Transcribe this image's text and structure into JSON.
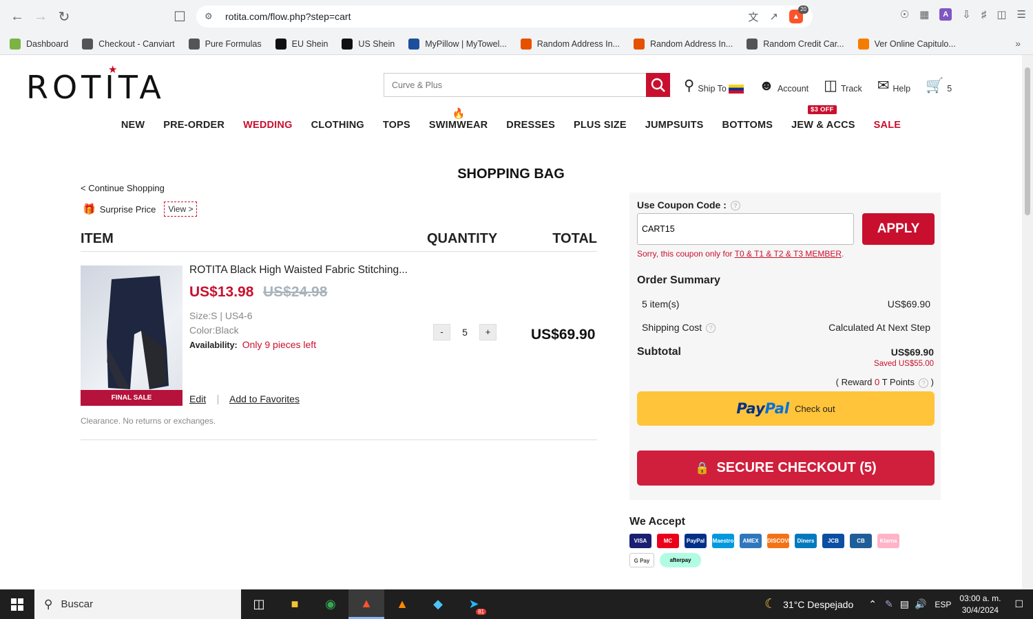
{
  "browser": {
    "url": "rotita.com/flow.php?step=cart",
    "extension_badge_count": "20"
  },
  "bookmarks": [
    {
      "label": "Dashboard",
      "color": "#7cb342"
    },
    {
      "label": "Checkout - Canviart",
      "color": "#555555"
    },
    {
      "label": "Pure Formulas",
      "color": "#555555"
    },
    {
      "label": "EU Shein",
      "color": "#111111"
    },
    {
      "label": "US Shein",
      "color": "#111111"
    },
    {
      "label": "MyPillow | MyTowel...",
      "color": "#1e4f9c"
    },
    {
      "label": "Random Address In...",
      "color": "#e65100"
    },
    {
      "label": "Random Address In...",
      "color": "#e65100"
    },
    {
      "label": "Random Credit Car...",
      "color": "#555555"
    },
    {
      "label": "Ver Online Capitulo...",
      "color": "#f57c00"
    }
  ],
  "site": {
    "logo": "ROTITA",
    "search_placeholder": "Curve & Plus",
    "header_links": {
      "ship_to": "Ship To",
      "account": "Account",
      "track": "Track",
      "help": "Help",
      "cart_count": "5"
    },
    "nav": [
      {
        "label": "NEW",
        "red": false
      },
      {
        "label": "PRE-ORDER",
        "red": false
      },
      {
        "label": "WEDDING",
        "red": true
      },
      {
        "label": "CLOTHING",
        "red": false
      },
      {
        "label": "TOPS",
        "red": false
      },
      {
        "label": "SWIMWEAR",
        "red": false
      },
      {
        "label": "DRESSES",
        "red": false
      },
      {
        "label": "PLUS SIZE",
        "red": false
      },
      {
        "label": "JUMPSUITS",
        "red": false
      },
      {
        "label": "BOTTOMS",
        "red": false
      },
      {
        "label": "JEW & ACCS",
        "red": false
      },
      {
        "label": "SALE",
        "red": true
      }
    ],
    "jew_badge": "$3 OFF"
  },
  "cart": {
    "title": "SHOPPING BAG",
    "continue": "< Continue Shopping",
    "surprise": "Surprise Price",
    "view": "View >",
    "headers": {
      "item": "ITEM",
      "quantity": "QUANTITY",
      "total": "TOTAL"
    },
    "item": {
      "name": "ROTITA Black High Waisted Fabric Stitching...",
      "price": "US$13.98",
      "old_price": "US$24.98",
      "size": "Size:S | US4-6",
      "color": "Color:Black",
      "availability_label": "Availability:",
      "availability_value": "Only 9 pieces left",
      "badge": "FINAL SALE",
      "qty_minus": "-",
      "qty": "5",
      "qty_plus": "+",
      "total": "US$69.90",
      "edit": "Edit",
      "favorites": "Add to Favorites",
      "note": "Clearance. No returns or exchanges."
    }
  },
  "summary": {
    "coupon_label": "Use Coupon Code :",
    "coupon_value": "CART15",
    "apply": "APPLY",
    "coupon_error_pre": "Sorry, this coupon only for ",
    "coupon_error_link": "T0 & T1 & T2 & T3 MEMBER",
    "coupon_error_post": ".",
    "title": "Order Summary",
    "items_label": "5 item(s)",
    "items_value": "US$69.90",
    "shipping_label": "Shipping Cost",
    "shipping_value": "Calculated At Next Step",
    "subtotal_label": "Subtotal",
    "subtotal_value": "US$69.90",
    "saved": "Saved US$55.00",
    "reward_pre": "( Reward ",
    "reward_pts": "0",
    "reward_post": " T Points",
    "paypal_pay": "Pay",
    "paypal_pal": "Pal",
    "paypal_text": "Check out",
    "secure": "SECURE CHECKOUT (5)",
    "we_accept": "We Accept",
    "payment_methods": [
      {
        "label": "VISA",
        "color": "#1a1f71"
      },
      {
        "label": "MC",
        "color": "#eb001b"
      },
      {
        "label": "PayPal",
        "color": "#003087"
      },
      {
        "label": "Maestro",
        "color": "#0099df"
      },
      {
        "label": "AMEX",
        "color": "#2e77bc"
      },
      {
        "label": "DISCOVER",
        "color": "#f47216"
      },
      {
        "label": "Diners",
        "color": "#0079be"
      },
      {
        "label": "JCB",
        "color": "#0b4ea2"
      },
      {
        "label": "CB",
        "color": "#1f5f99"
      },
      {
        "label": "Klarna",
        "color": "#ffb3c7"
      }
    ],
    "gpay": "G Pay",
    "afterpay": "afterpay"
  },
  "taskbar": {
    "search": "Buscar",
    "weather": "31°C  Despejado",
    "lang": "ESP",
    "time": "03:00 a. m.",
    "date": "30/4/2024",
    "telegram_badge": "81"
  }
}
